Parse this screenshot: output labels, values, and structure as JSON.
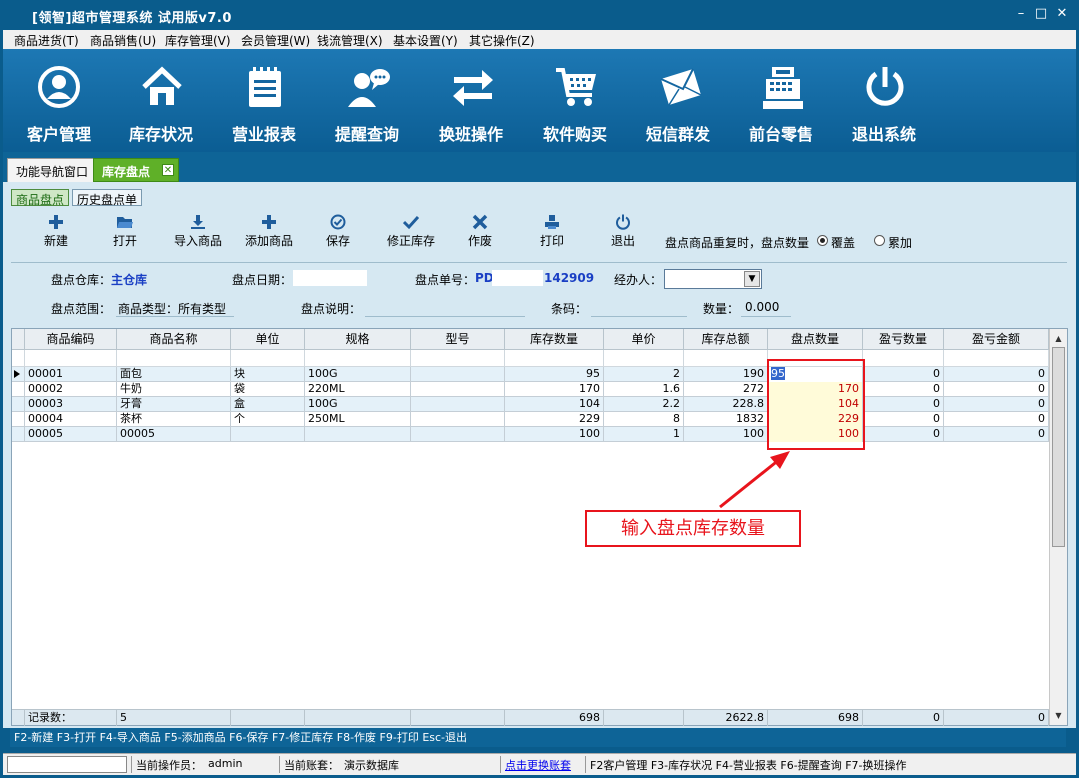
{
  "window": {
    "title": "[领智]超市管理系统 试用版v7.0",
    "minimize": "–",
    "maximize": "□",
    "close": "✕"
  },
  "menu": [
    "商品进货(T)",
    "商品销售(U)",
    "库存管理(V)",
    "会员管理(W)",
    "钱流管理(X)",
    "基本设置(Y)",
    "其它操作(Z)"
  ],
  "nav": [
    {
      "label": "客户管理",
      "icon": "user-circle-icon"
    },
    {
      "label": "库存状况",
      "icon": "house-icon"
    },
    {
      "label": "营业报表",
      "icon": "notepad-icon"
    },
    {
      "label": "提醒查询",
      "icon": "chat-user-icon"
    },
    {
      "label": "换班操作",
      "icon": "swap-arrows-icon"
    },
    {
      "label": "软件购买",
      "icon": "shopping-cart-icon"
    },
    {
      "label": "短信群发",
      "icon": "envelope-icon"
    },
    {
      "label": "前台零售",
      "icon": "cash-register-icon"
    },
    {
      "label": "退出系统",
      "icon": "power-icon"
    }
  ],
  "tabs": {
    "home": "功能导航窗口",
    "active": "库存盘点",
    "close": "✕"
  },
  "subtabs": [
    "商品盘点",
    "历史盘点单"
  ],
  "toolbar": [
    {
      "label": "新建",
      "icon": "plus-icon"
    },
    {
      "label": "打开",
      "icon": "folder-icon"
    },
    {
      "label": "导入商品",
      "icon": "import-icon"
    },
    {
      "label": "添加商品",
      "icon": "plus-icon"
    },
    {
      "label": "保存",
      "icon": "check-circle-icon"
    },
    {
      "label": "修正库存",
      "icon": "checkmark-icon"
    },
    {
      "label": "作废",
      "icon": "x-icon"
    },
    {
      "label": "打印",
      "icon": "printer-icon"
    },
    {
      "label": "退出",
      "icon": "power-icon"
    }
  ],
  "dup_option": {
    "label": "盘点商品重复时，盘点数量",
    "overwrite": "覆盖",
    "accumulate": "累加",
    "selected": "覆盖"
  },
  "form": {
    "warehouse_label": "盘点仓库：",
    "warehouse_value": "主仓库",
    "date_label": "盘点日期：",
    "order_label": "盘点单号：",
    "order_prefix": "PD",
    "order_suffix": "142909",
    "handler_label": "经办人：",
    "range_label": "盘点范围：",
    "range_value": "商品类型：所有类型",
    "note_label": "盘点说明：",
    "barcode_label": "条码：",
    "qty_label": "数量：",
    "qty_value": "0.000"
  },
  "grid": {
    "columns": [
      "商品编码",
      "商品名称",
      "单位",
      "规格",
      "型号",
      "库存数量",
      "单价",
      "库存总额",
      "盘点数量",
      "盈亏数量",
      "盈亏金额"
    ],
    "rows": [
      [
        "00001",
        "面包",
        "块",
        "100G",
        "",
        "95",
        "2",
        "190",
        "95",
        "0",
        "0"
      ],
      [
        "00002",
        "牛奶",
        "袋",
        "220ML",
        "",
        "170",
        "1.6",
        "272",
        "170",
        "0",
        "0"
      ],
      [
        "00003",
        "牙膏",
        "盒",
        "100G",
        "",
        "104",
        "2.2",
        "228.8",
        "104",
        "0",
        "0"
      ],
      [
        "00004",
        "茶杯",
        "个",
        "250ML",
        "",
        "229",
        "8",
        "1832",
        "229",
        "0",
        "0"
      ],
      [
        "00005",
        "00005",
        "",
        "",
        "",
        "100",
        "1",
        "100",
        "100",
        "0",
        "0"
      ]
    ],
    "footer": {
      "label": "记录数：",
      "count": "5",
      "stock_qty": "698",
      "stock_total": "2622.8",
      "check_qty": "698",
      "diff_qty": "0",
      "diff_amount": "0"
    }
  },
  "annotation": "输入盘点库存数量",
  "hotkeys": "F2-新建 F3-打开 F4-导入商品 F5-添加商品 F6-保存 F7-修正库存 F8-作废 F9-打印 Esc-退出",
  "status": {
    "operator_label": "当前操作员：",
    "operator": "admin",
    "account_label": "当前账套：",
    "account": "演示数据库",
    "switch_link": "点击更换账套",
    "shortcuts": "F2客户管理 F3-库存状况 F4-营业报表 F6-提醒查询 F7-换班操作"
  },
  "colors": {
    "brand_blue": "#0a5c8c",
    "active_tab_green": "#5fb028",
    "annotation_red": "#e8141c"
  }
}
